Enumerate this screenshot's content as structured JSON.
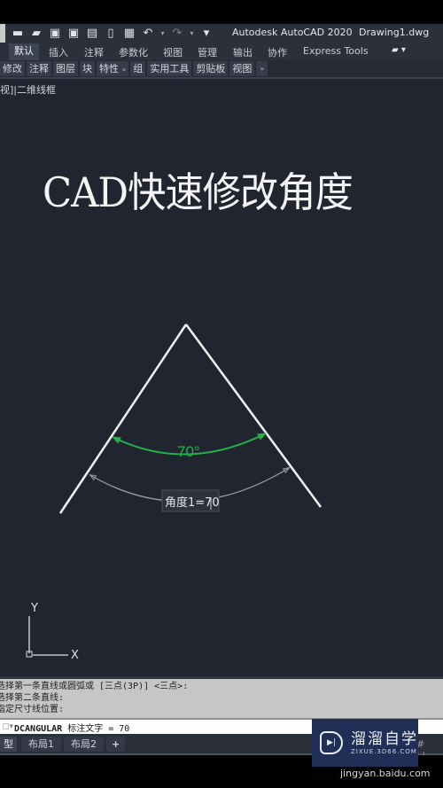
{
  "app": {
    "title": "Autodesk AutoCAD 2020",
    "filename": "Drawing1.dwg"
  },
  "quick_access": [
    {
      "icon": "new-file-icon",
      "glyph": "▬"
    },
    {
      "icon": "open-folder-icon",
      "glyph": "▰"
    },
    {
      "icon": "save-icon",
      "glyph": "▣"
    },
    {
      "icon": "save-as-icon",
      "glyph": "▣"
    },
    {
      "icon": "publish-icon",
      "glyph": "▤"
    },
    {
      "icon": "share-icon",
      "glyph": "▯"
    },
    {
      "icon": "print-icon",
      "glyph": "▦"
    },
    {
      "icon": "undo-icon",
      "glyph": "↶"
    },
    {
      "icon": "redo-icon",
      "glyph": "↷"
    },
    {
      "icon": "customize-dropdown-icon",
      "glyph": "▾"
    }
  ],
  "ribbon_tabs": [
    "默认",
    "插入",
    "注释",
    "参数化",
    "视图",
    "管理",
    "输出",
    "协作",
    "Express Tools"
  ],
  "ribbon_active_tab": "默认",
  "ribbon_extra_icon": "▰ ▾",
  "panels": [
    "修改",
    "注释",
    "图层",
    "块",
    "特性",
    "组",
    "实用工具",
    "剪贴板",
    "视图"
  ],
  "panel_more": "»",
  "viewport": {
    "label": "视]|二维线框",
    "overlay_title": "CAD快速修改角度",
    "dimension": {
      "angle_value": 70,
      "angle_text": "70°",
      "edit_box_text": "角度1=70"
    },
    "ucs": {
      "x_label": "X",
      "y_label": "Y"
    },
    "colors": {
      "background": "#212530",
      "lines": "#f2f2f2",
      "dimension": "#22b24c",
      "preview_dimension": "#9a9ca3"
    }
  },
  "command_history": [
    "选择第一条直线或圆弧或 [三点(3P)] <三点>:",
    "选择第二条直线:",
    "指定尺寸线位置:"
  ],
  "command_input": {
    "command": "DCANGULAR",
    "rest": " 标注文字 = 70"
  },
  "layout_tabs": [
    "型",
    "布局1",
    "布局2",
    "+"
  ],
  "status_icons": "# ⁞⁞",
  "watermark": {
    "title": "溜溜自学",
    "subtitle": "ZIXUE.3D66.COM",
    "play_glyph": "▶|"
  },
  "source_caption": "jingyan.baidu.com"
}
